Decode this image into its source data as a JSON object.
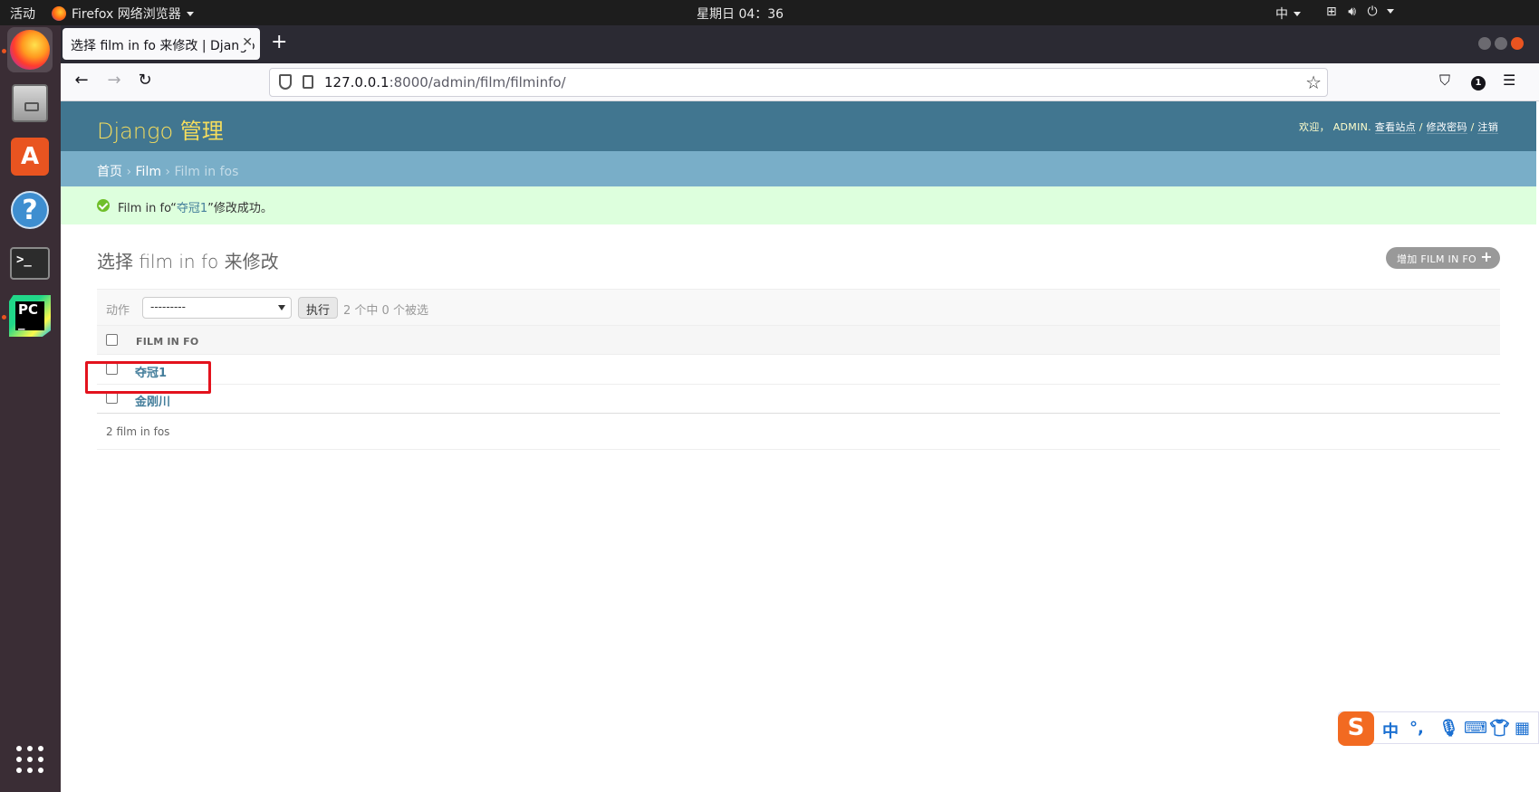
{
  "system": {
    "activities": "活动",
    "app_name": "Firefox 网络浏览器",
    "clock": "星期日 04：36",
    "input_method": "中"
  },
  "browser": {
    "tab_title": "选择 film in fo 来修改 | Django",
    "url_host": "127.0.0.1",
    "url_path": ":8000/admin/film/filminfo/",
    "notification_count": "1"
  },
  "admin": {
    "branding": "Django 管理",
    "welcome": "欢迎，",
    "username": "ADMIN",
    "view_site": "查看站点",
    "change_password": "修改密码",
    "logout": "注销",
    "separator": "/",
    "breadcrumbs": {
      "home": "首页",
      "app": "Film",
      "current": "Film in fos",
      "sep": "›"
    },
    "message": {
      "prefix": "Film in fo“",
      "link": "夺冠1",
      "suffix": "”修改成功。"
    },
    "page_title": "选择 film in fo 来修改",
    "add_button": "增加 FILM IN FO",
    "actions": {
      "label": "动作",
      "selected_option": "---------",
      "go_button": "执行",
      "counter": "2 个中 0 个被选"
    },
    "table": {
      "column_header": "FILM IN FO",
      "rows": [
        "夺冠1",
        "金刚川"
      ]
    },
    "paginator": "2 film in fos"
  },
  "ime": {
    "logo": "S",
    "mode": "中",
    "punct": "°,"
  },
  "colors": {
    "header_bg": "#417690",
    "breadcrumb_bg": "#79aec8",
    "message_bg": "#ddffdd",
    "link": "#447e9b",
    "branding": "#f5dd5d",
    "highlight": "#e3121d"
  }
}
